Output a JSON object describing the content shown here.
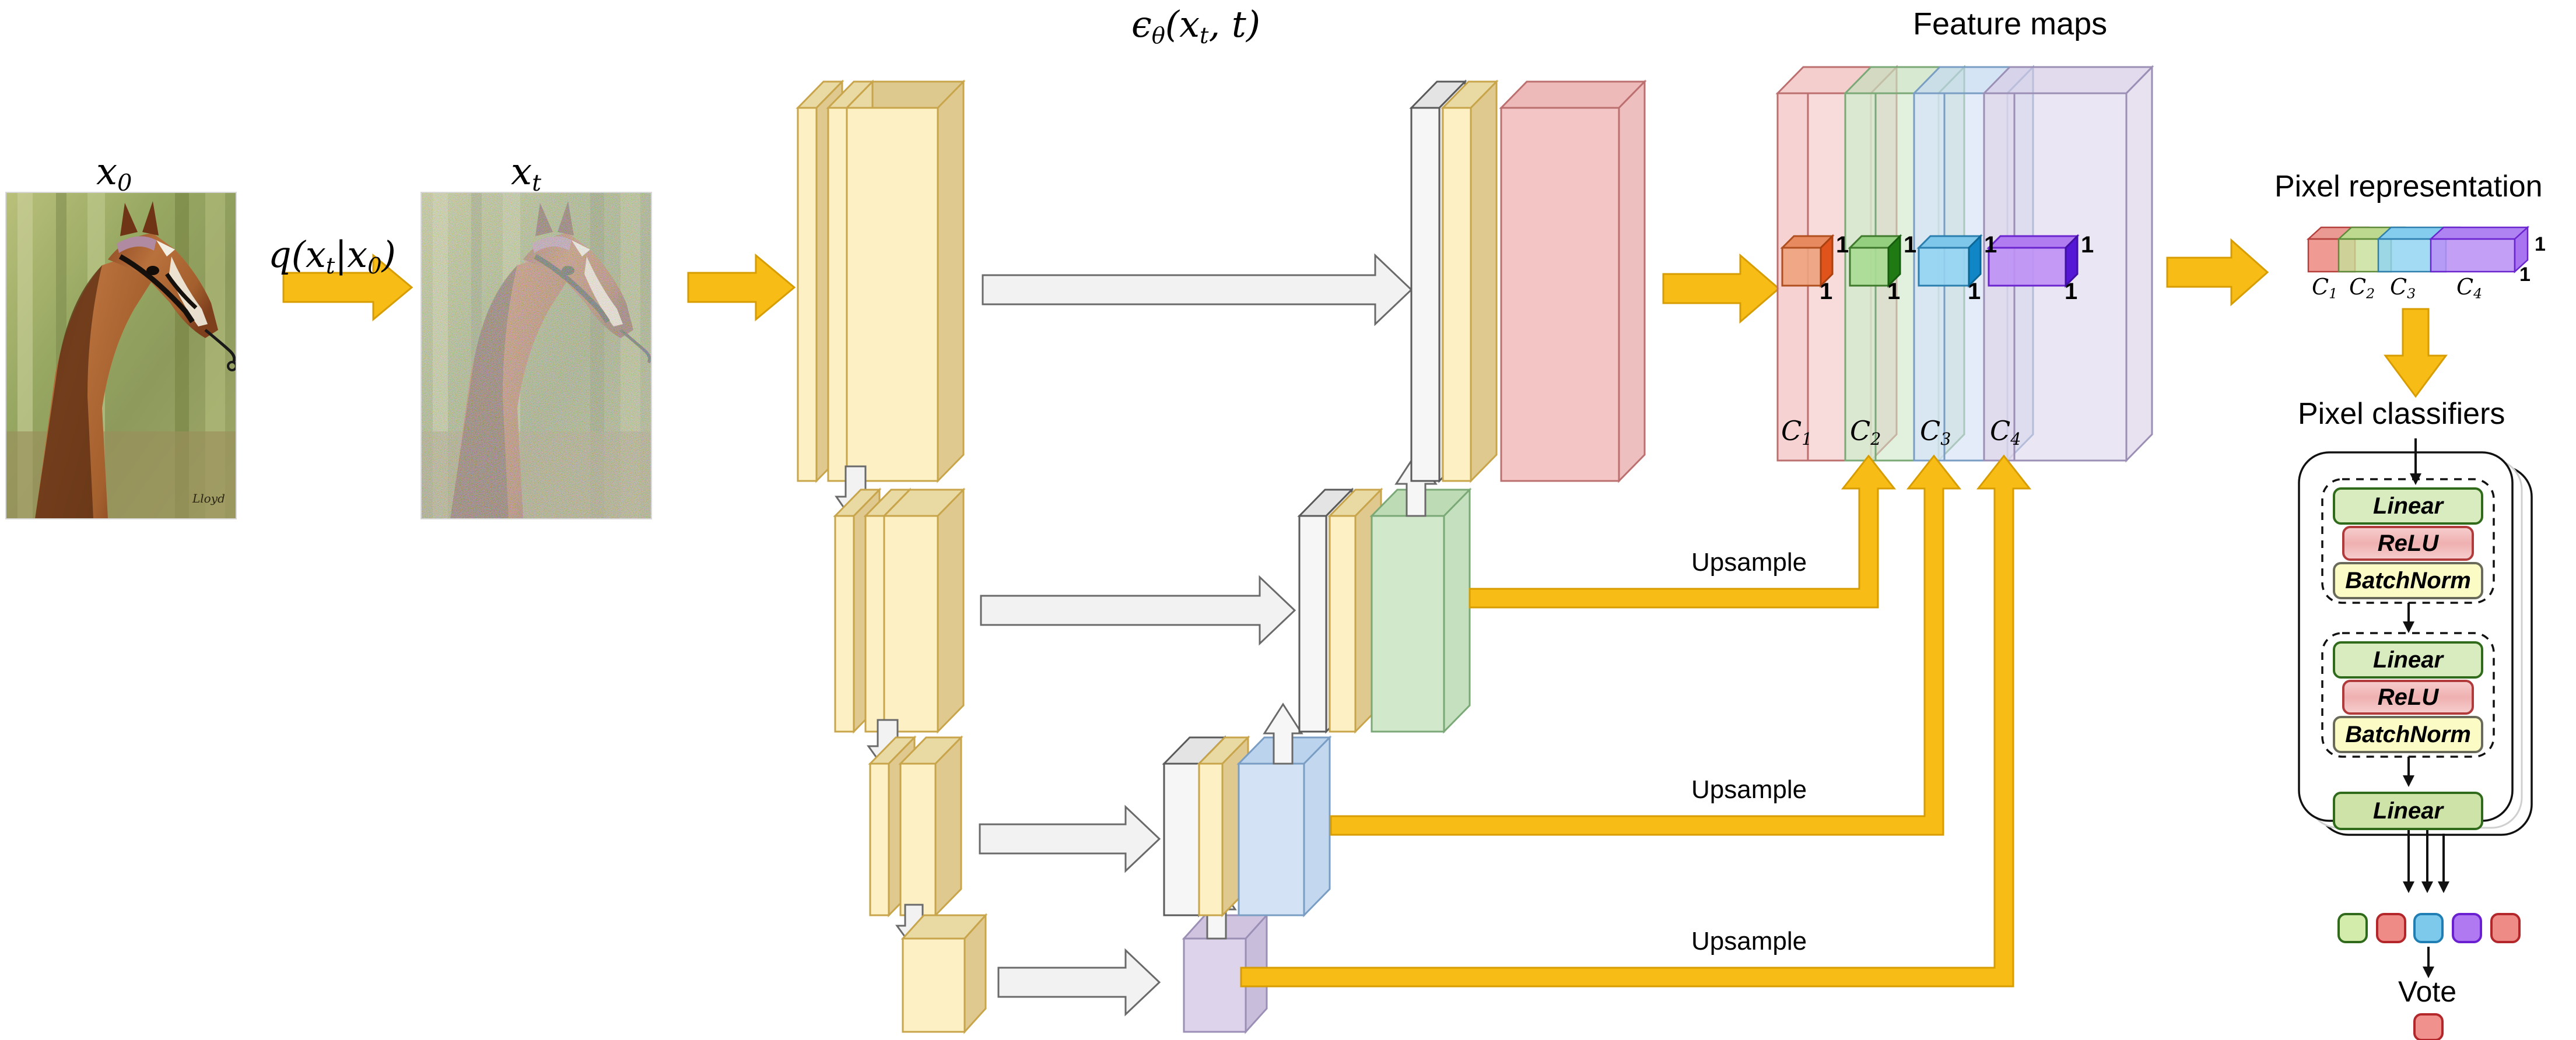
{
  "diagram": {
    "title_eps": "ϵθ(xt, t)",
    "labels": {
      "x0": "x0",
      "xt": "xt",
      "q": "q(xt|x0)",
      "eps_main": "ϵ",
      "eps_sub": "θ",
      "eps_args": "(x",
      "feature_maps": "Feature maps",
      "pixel_representation": "Pixel representation",
      "pixel_classifiers": "Pixel classifiers",
      "vote": "Vote",
      "upsample": "Upsample"
    },
    "upsample_labels": [
      "Upsample",
      "Upsample",
      "Upsample"
    ],
    "channel_labels": [
      "C1",
      "C2",
      "C3",
      "C4"
    ],
    "dim_label": "1",
    "feature_map_dims": [
      {
        "d1": "1",
        "d2": "1"
      },
      {
        "d1": "1",
        "d2": "1"
      },
      {
        "d1": "1",
        "d2": "1"
      },
      {
        "d1": "1",
        "d2": "1"
      }
    ],
    "pixel_rep_dims": {
      "d1": "1",
      "d2": "1"
    },
    "classifier_blocks": [
      {
        "label": "Linear",
        "color": "#d9ecc0",
        "border": "#2f6b1b"
      },
      {
        "label": "ReLU",
        "color": "#f3c3c3",
        "border": "#b13a3a"
      },
      {
        "label": "BatchNorm",
        "color": "#fbfbc6",
        "border": "#6a6a5a"
      },
      {
        "label": "Linear",
        "color": "#d9ecc0",
        "border": "#2f6b1b"
      },
      {
        "label": "ReLU",
        "color": "#f3c3c3",
        "border": "#b13a3a"
      },
      {
        "label": "BatchNorm",
        "color": "#fbfbc6",
        "border": "#6a6a5a"
      },
      {
        "label": "Linear",
        "color": "#cde3a8",
        "border": "#2f6b1b"
      }
    ],
    "vote_inputs": [
      {
        "color": "#d3ecab",
        "border": "#2f6b1b"
      },
      {
        "color": "#ee8b87",
        "border": "#b3272b"
      },
      {
        "color": "#7cc9ec",
        "border": "#1f7fb5"
      },
      {
        "color": "#b079f2",
        "border": "#6a1fd0"
      },
      {
        "color": "#ee8b87",
        "border": "#b3272b"
      }
    ],
    "vote_output": {
      "color": "#f0918d",
      "border": "#b3272b"
    },
    "palette": {
      "yellow_face": "#fdf0c4",
      "yellow_top": "#e9d9a3",
      "yellow_side": "#dfc98f",
      "yellow_border": "#c8a44a",
      "white_face": "#f6f6f6",
      "white_border": "#5a5a5a",
      "red_face": "#f4c5c5",
      "red_border": "#bc6f6f",
      "green_face": "#cfe6c8",
      "green_border": "#7aa876",
      "blue_face": "#cfe0f3",
      "blue_border": "#7a9dc4",
      "purple_face": "#dcd3ea",
      "purple_border": "#9b8fb5",
      "arrow_yellow": "#f8bc16",
      "arrow_yellow_border": "#d79c00",
      "arrow_grey_fill": "#f2f2f2",
      "arrow_grey_border": "#6a6a6a"
    }
  }
}
